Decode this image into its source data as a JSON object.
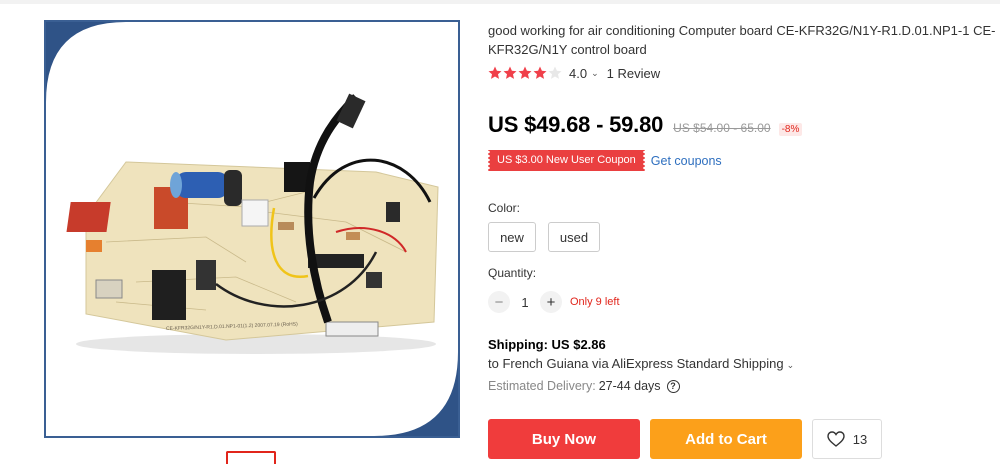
{
  "product": {
    "title": "good working for air conditioning Computer board CE-KFR32G/N1Y-R1.D.01.NP1-1 CE-KFR32G/N1Y control board",
    "rating": "4.0",
    "rating_stars": 4,
    "reviews": "1 Review",
    "board_silkscreen": "CE-KFR32G/N1Y-R1.D.01.NP1-01(1.2)   2007.07.19 (RoHS)"
  },
  "price": {
    "current": "US $49.68 - 59.80",
    "original": "US $54.00 - 65.00",
    "discount": "-8%"
  },
  "coupon": {
    "label": "US $3.00 New User Coupon",
    "link": "Get coupons"
  },
  "color": {
    "label": "Color:",
    "options": [
      "new",
      "used"
    ]
  },
  "quantity": {
    "label": "Quantity:",
    "minus": "−",
    "value": "1",
    "plus": "+",
    "stock_note": "Only 9 left"
  },
  "shipping": {
    "title": "Shipping: US $2.86",
    "destination": "to French Guiana via AliExpress Standard Shipping",
    "estimated_label": "Estimated Delivery:",
    "estimated_days": "27-44 days"
  },
  "actions": {
    "buy_now": "Buy Now",
    "add_to_cart": "Add to Cart",
    "wishlist_count": "13"
  },
  "colors": {
    "accent_red": "#e1251b",
    "buy_button": "#f03c3c",
    "cart_button": "#fca01a",
    "coupon": "#ea3f40",
    "star": "#f0404a",
    "link": "#2e6fbf"
  },
  "icons": {
    "star": "star-icon",
    "help": "question-circle-icon",
    "wishlist": "heart-icon",
    "dropdown": "chevron-down-icon"
  }
}
